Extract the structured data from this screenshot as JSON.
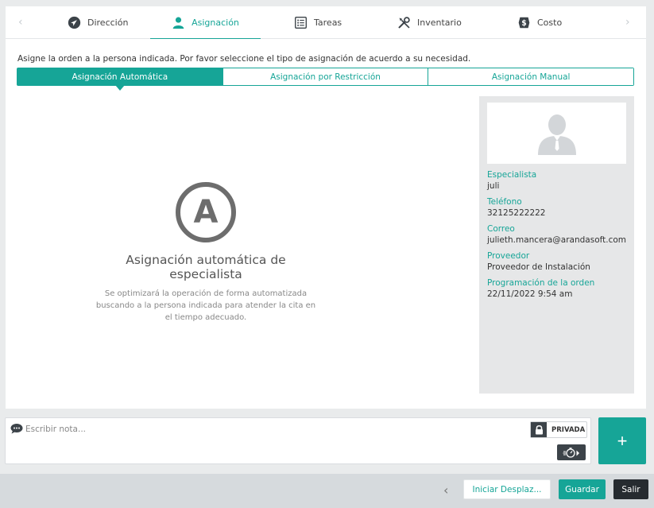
{
  "tabs": [
    {
      "label": "Dirección",
      "icon": "navigation-arrow-icon"
    },
    {
      "label": "Asignación",
      "icon": "person-icon",
      "active": true
    },
    {
      "label": "Tareas",
      "icon": "checklist-icon"
    },
    {
      "label": "Inventario",
      "icon": "tools-icon"
    },
    {
      "label": "Costo",
      "icon": "dollar-tag-icon"
    }
  ],
  "instructions": "Asigne la orden a la persona indicada. Por favor seleccione el tipo de asignación de acuerdo a su necesidad.",
  "assignment_types": [
    {
      "label": "Asignación Automática",
      "active": true
    },
    {
      "label": "Asignación por Restricción"
    },
    {
      "label": "Asignación Manual"
    }
  ],
  "auto": {
    "badge": "A",
    "title": "Asignación automática de especialista",
    "description": "Se optimizará la operación de forma automatizada buscando a la persona indicada para atender la cita en el tiempo adecuado."
  },
  "specialist": {
    "specialist_label": "Especialista",
    "specialist_value": "juli",
    "phone_label": "Teléfono",
    "phone_value": "32125222222",
    "email_label": "Correo",
    "email_value": "julieth.mancera@arandasoft.com",
    "provider_label": "Proveedor",
    "provider_value": "Proveedor de Instalación",
    "schedule_label": "Programación de la orden",
    "schedule_value": "22/11/2022 9:54 am"
  },
  "note": {
    "placeholder": "Escribir nota...",
    "private_label": "PRIVADA",
    "add_label": "+"
  },
  "footer": {
    "start_label": "Iniciar Desplaz...",
    "save_label": "Guardar",
    "exit_label": "Salir"
  },
  "colors": {
    "accent": "#16a597",
    "dark": "#262b30"
  }
}
